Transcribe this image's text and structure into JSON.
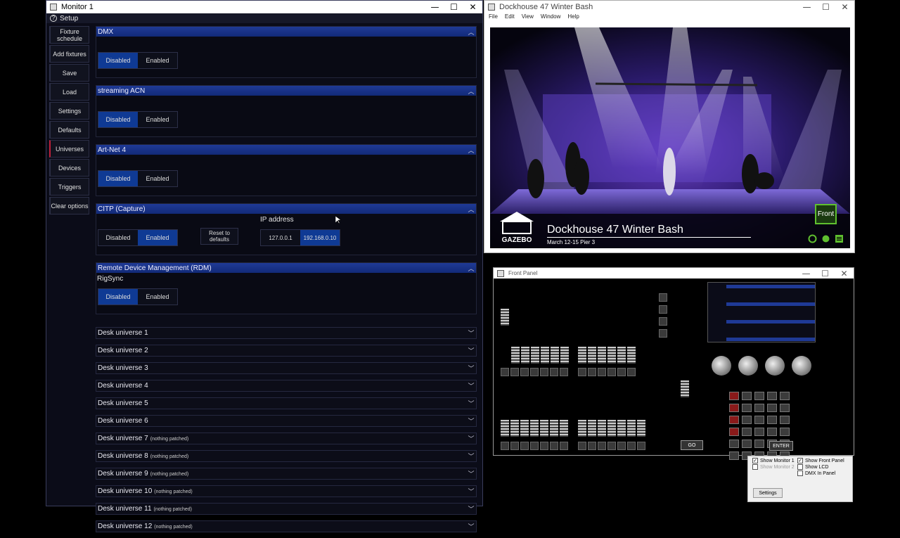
{
  "monitor1": {
    "title": "Monitor 1",
    "controls": {
      "minimize": "—",
      "maximize": "☐",
      "close": "✕"
    },
    "setup_label": "Setup",
    "help_glyph": "?",
    "sidebar": [
      {
        "label": "Fixture schedule"
      },
      {
        "label": "Add fixtures"
      },
      {
        "label": "Save"
      },
      {
        "label": "Load"
      },
      {
        "label": "Settings"
      },
      {
        "label": "Defaults"
      },
      {
        "label": "Universes",
        "active": true
      },
      {
        "label": "Devices"
      },
      {
        "label": "Triggers"
      },
      {
        "label": "Clear options"
      }
    ],
    "sections": {
      "dmx": {
        "title": "DMX",
        "off": "Disabled",
        "on": "Enabled",
        "selected": "Disabled"
      },
      "sacn": {
        "title": "streaming ACN",
        "off": "Disabled",
        "on": "Enabled",
        "selected": "Disabled"
      },
      "artnet": {
        "title": "Art-Net 4",
        "off": "Disabled",
        "on": "Enabled",
        "selected": "Disabled"
      },
      "citp": {
        "title": "CITP (Capture)",
        "off": "Disabled",
        "on": "Enabled",
        "selected": "Enabled",
        "reset": "Reset to defaults",
        "ip_label": "IP address",
        "ip_options": [
          "127.0.0.1",
          "192.168.0.10"
        ],
        "ip_selected": "192.168.0.10"
      },
      "rdm": {
        "title": "Remote Device Management (RDM)",
        "sub": "RigSync",
        "off": "Disabled",
        "on": "Enabled",
        "selected": "Disabled"
      }
    },
    "universes": [
      {
        "name": "Desk universe 1",
        "note": ""
      },
      {
        "name": "Desk universe 2",
        "note": ""
      },
      {
        "name": "Desk universe 3",
        "note": ""
      },
      {
        "name": "Desk universe 4",
        "note": ""
      },
      {
        "name": "Desk universe 5",
        "note": ""
      },
      {
        "name": "Desk universe 6",
        "note": ""
      },
      {
        "name": "Desk universe 7",
        "note": "(nothing patched)"
      },
      {
        "name": "Desk universe 8",
        "note": "(nothing patched)"
      },
      {
        "name": "Desk universe 9",
        "note": "(nothing patched)"
      },
      {
        "name": "Desk universe 10",
        "note": "(nothing patched)"
      },
      {
        "name": "Desk universe 11",
        "note": "(nothing patched)"
      },
      {
        "name": "Desk universe 12",
        "note": "(nothing patched)"
      }
    ]
  },
  "dockhouse": {
    "title": "Dockhouse 47 Winter Bash",
    "menu": [
      "File",
      "Edit",
      "View",
      "Window",
      "Help"
    ],
    "banner_title": "Dockhouse 47 Winter Bash",
    "banner_sub": "March 12-15 Pier 3",
    "badge": "Front",
    "logo": "GAZEBO"
  },
  "front_panel": {
    "title": "Front Panel",
    "go_label": "GO",
    "enter_label": "ENTER"
  },
  "options": {
    "show_monitor1": "Show Monitor 1",
    "show_monitor2": "Show Monitor 2",
    "show_front_panel": "Show Front Panel",
    "show_lcd": "Show LCD",
    "dmx_in_panel": "DMX In Panel",
    "settings": "Settings"
  },
  "colors": {
    "accent": "#0f3a94",
    "section_head": "#1f3a96",
    "rigsync_border": "#c0203a",
    "front_badge": "#5fbf2f"
  }
}
